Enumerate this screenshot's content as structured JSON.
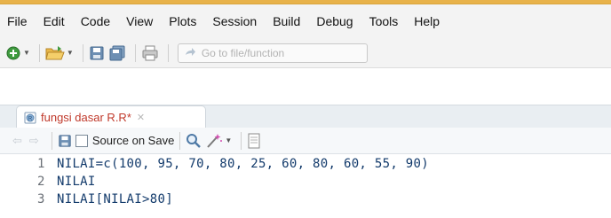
{
  "menubar": {
    "items": [
      {
        "label": "File"
      },
      {
        "label": "Edit"
      },
      {
        "label": "Code"
      },
      {
        "label": "View"
      },
      {
        "label": "Plots"
      },
      {
        "label": "Session"
      },
      {
        "label": "Build"
      },
      {
        "label": "Debug"
      },
      {
        "label": "Tools"
      },
      {
        "label": "Help"
      }
    ]
  },
  "toolbar": {
    "goto_placeholder": "Go to file/function"
  },
  "editor": {
    "tab": {
      "title": "fungsi dasar R.R*"
    },
    "source_on_save_label": "Source on Save",
    "lines": [
      {
        "num": "1",
        "text": "NILAI=c(100, 95, 70, 80, 25, 60, 80, 60, 55, 90)"
      },
      {
        "num": "2",
        "text": "NILAI"
      },
      {
        "num": "3",
        "text": "NILAI[NILAI>80]"
      }
    ]
  },
  "colors": {
    "accent_orange": "#e8b24a",
    "tab_title": "#c0392b",
    "code_text": "#123a6b"
  }
}
